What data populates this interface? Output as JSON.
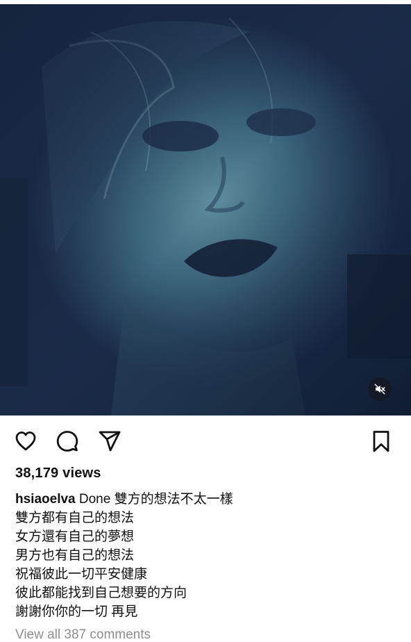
{
  "post": {
    "views": "38,179 views",
    "username": "hsiaoelva",
    "caption_lines": [
      "Done 雙方的想法不太一樣",
      "雙方都有自己的想法",
      "女方還有自己的夢想",
      "男方也有自己的想法",
      "祝福彼此一切平安健康",
      "彼此都能找到自己想要的方向",
      "謝謝你你的一切  再見"
    ],
    "view_comments": "View all 387 comments"
  },
  "icons": {
    "like": "heart-icon",
    "comment": "comment-icon",
    "share": "send-icon",
    "save": "bookmark-icon",
    "mute": "speaker-muted-icon"
  },
  "colors": {
    "text": "#111111",
    "secondary_text": "#8e8e8e",
    "media_tint": "#1f3a5a"
  }
}
